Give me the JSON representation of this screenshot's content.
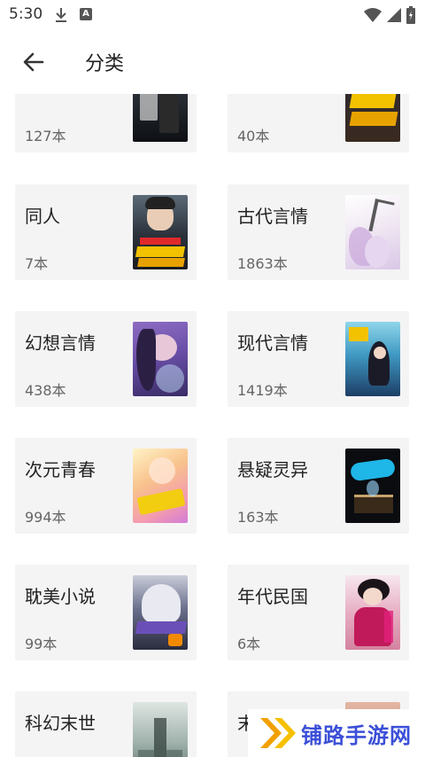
{
  "status_bar": {
    "time": "5:30",
    "icons": [
      "download-icon",
      "a-notification-icon",
      "wifi-icon",
      "signal-icon",
      "battery-icon"
    ]
  },
  "app_bar": {
    "back_icon": "arrow-left-icon",
    "title": "分类"
  },
  "categories": [
    {
      "name": "",
      "count": "127本"
    },
    {
      "name": "",
      "count": "40本"
    },
    {
      "name": "同人",
      "count": "7本"
    },
    {
      "name": "古代言情",
      "count": "1863本"
    },
    {
      "name": "幻想言情",
      "count": "438本"
    },
    {
      "name": "现代言情",
      "count": "1419本"
    },
    {
      "name": "次元青春",
      "count": "994本"
    },
    {
      "name": "悬疑灵异",
      "count": "163本"
    },
    {
      "name": "耽美小说",
      "count": "99本"
    },
    {
      "name": "年代民国",
      "count": "6本"
    },
    {
      "name": "科幻末世",
      "count": ""
    },
    {
      "name": "末世",
      "count": ""
    }
  ],
  "watermark": {
    "text": "铺路手游网",
    "color": "#3b4fd8"
  }
}
